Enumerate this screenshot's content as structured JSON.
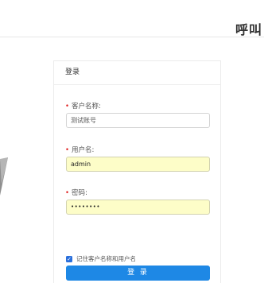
{
  "header": {
    "title": "呼叫"
  },
  "login": {
    "title": "登录",
    "customer_label": "客户名称:",
    "customer_value": "测试账号",
    "username_label": "用户名:",
    "username_value": "admin",
    "password_label": "密码:",
    "password_mask": "••••••••",
    "remember_label": "记住客户名称和用户名",
    "remember_checked": true,
    "submit_label": "登 录"
  },
  "colors": {
    "accent": "#1e88e5",
    "autofill": "#fdfdc8",
    "required": "#e02020"
  }
}
